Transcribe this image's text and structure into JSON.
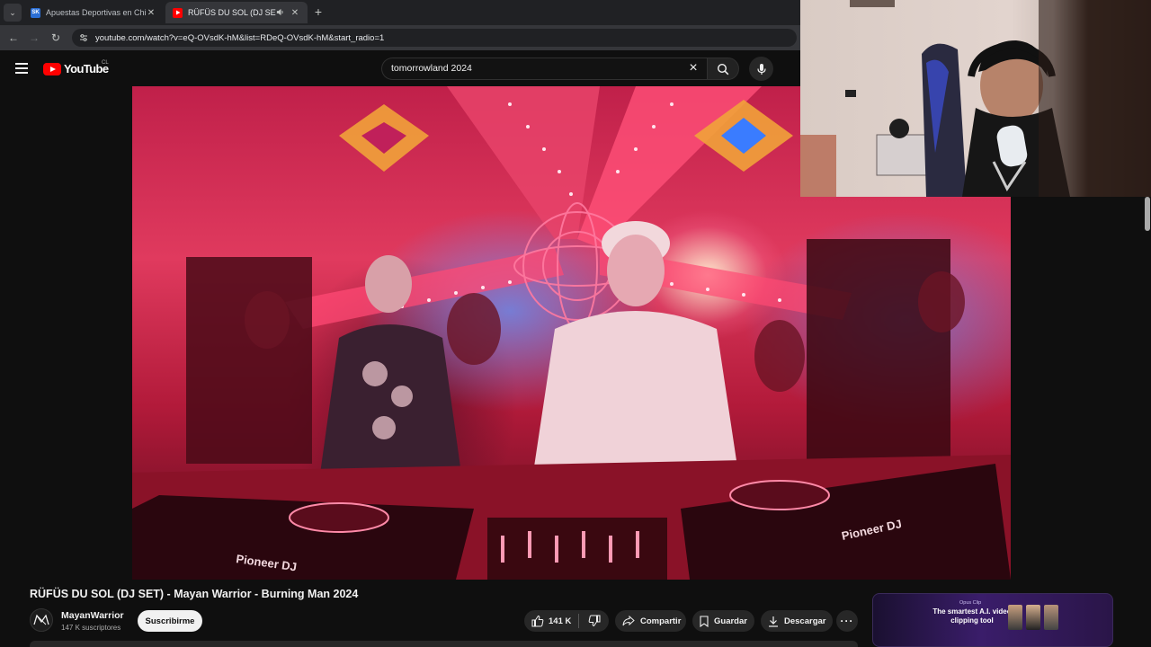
{
  "browser": {
    "tabs": [
      {
        "title": "Apuestas Deportivas en Chile |",
        "favicon": "sports-betting-favicon",
        "active": false
      },
      {
        "title": "RÜFÜS DU SOL (DJ SET) - M",
        "favicon": "youtube-favicon",
        "active": true,
        "audio": "speaker-icon"
      }
    ],
    "new_tab": "+",
    "url": "youtube.com/watch?v=eQ-OVsdK-hM&list=RDeQ-OVsdK-hM&start_radio=1"
  },
  "masthead": {
    "logo_text": "YouTube",
    "region": "CL",
    "search_query": "tomorrowland 2024"
  },
  "video": {
    "title": "RÜFÜS DU SOL (DJ SET) - Mayan Warrior - Burning Man 2024",
    "overlay_brand": "Pioneer DJ"
  },
  "channel": {
    "name": "MayanWarrior",
    "subscribers": "147 K suscriptores",
    "subscribe_label": "Suscribirme"
  },
  "actions": {
    "likes": "141 K",
    "share_label": "Compartir",
    "save_label": "Guardar",
    "download_label": "Descargar",
    "more": "···"
  },
  "ad": {
    "brand": "Opus Clip",
    "headline": "The smartest A.I. video clipping tool"
  },
  "colors": {
    "background": "#0f0f0f",
    "youtube_red": "#ff0000",
    "pill": "#272727",
    "subscribe_bg": "#f1f1f1",
    "text_secondary": "#aaaaaa"
  }
}
